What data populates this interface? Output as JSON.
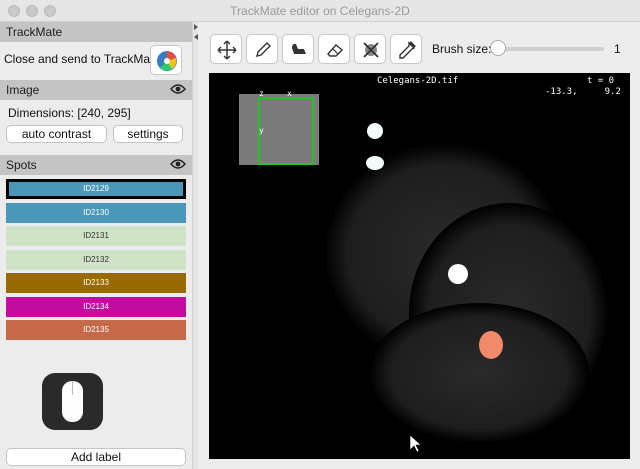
{
  "window": {
    "title": "TrackMate editor on Celegans-2D"
  },
  "sidebar": {
    "trackmate_header": "TrackMate",
    "close_send_label": "Close and send to TrackMate",
    "image_header": "Image",
    "dimensions_text": "Dimensions: [240, 295]",
    "auto_contrast_label": "auto contrast",
    "settings_label": "settings",
    "spots_header": "Spots",
    "spots": [
      {
        "label": "ID2129",
        "color": "#4a98b9",
        "selected": true
      },
      {
        "label": "ID2130",
        "color": "#4a98b9",
        "selected": false
      },
      {
        "label": "ID2131",
        "color": "#cfe3c6",
        "selected": false
      },
      {
        "label": "ID2132",
        "color": "#cfe3c6",
        "selected": false
      },
      {
        "label": "ID2133",
        "color": "#996a00",
        "selected": false
      },
      {
        "label": "ID2134",
        "color": "#c40ba0",
        "selected": false
      },
      {
        "label": "ID2135",
        "color": "#c6684a",
        "selected": false
      }
    ],
    "add_label": "Add label"
  },
  "toolbar": {
    "tools": [
      "move-icon",
      "pencil-icon",
      "bucket-icon",
      "eraser-icon",
      "delete-all-icon",
      "eyedropper-icon"
    ],
    "brush_size_label": "Brush size:",
    "brush_size_value": "1",
    "brush_size_fraction": 0.0
  },
  "canvas": {
    "image_name": "Celegans-2D.tif",
    "time_text": "t = 0",
    "coords_text": "-13.3,     9.2",
    "overview_z": "z",
    "overview_x": "x",
    "overview_y": "y"
  }
}
